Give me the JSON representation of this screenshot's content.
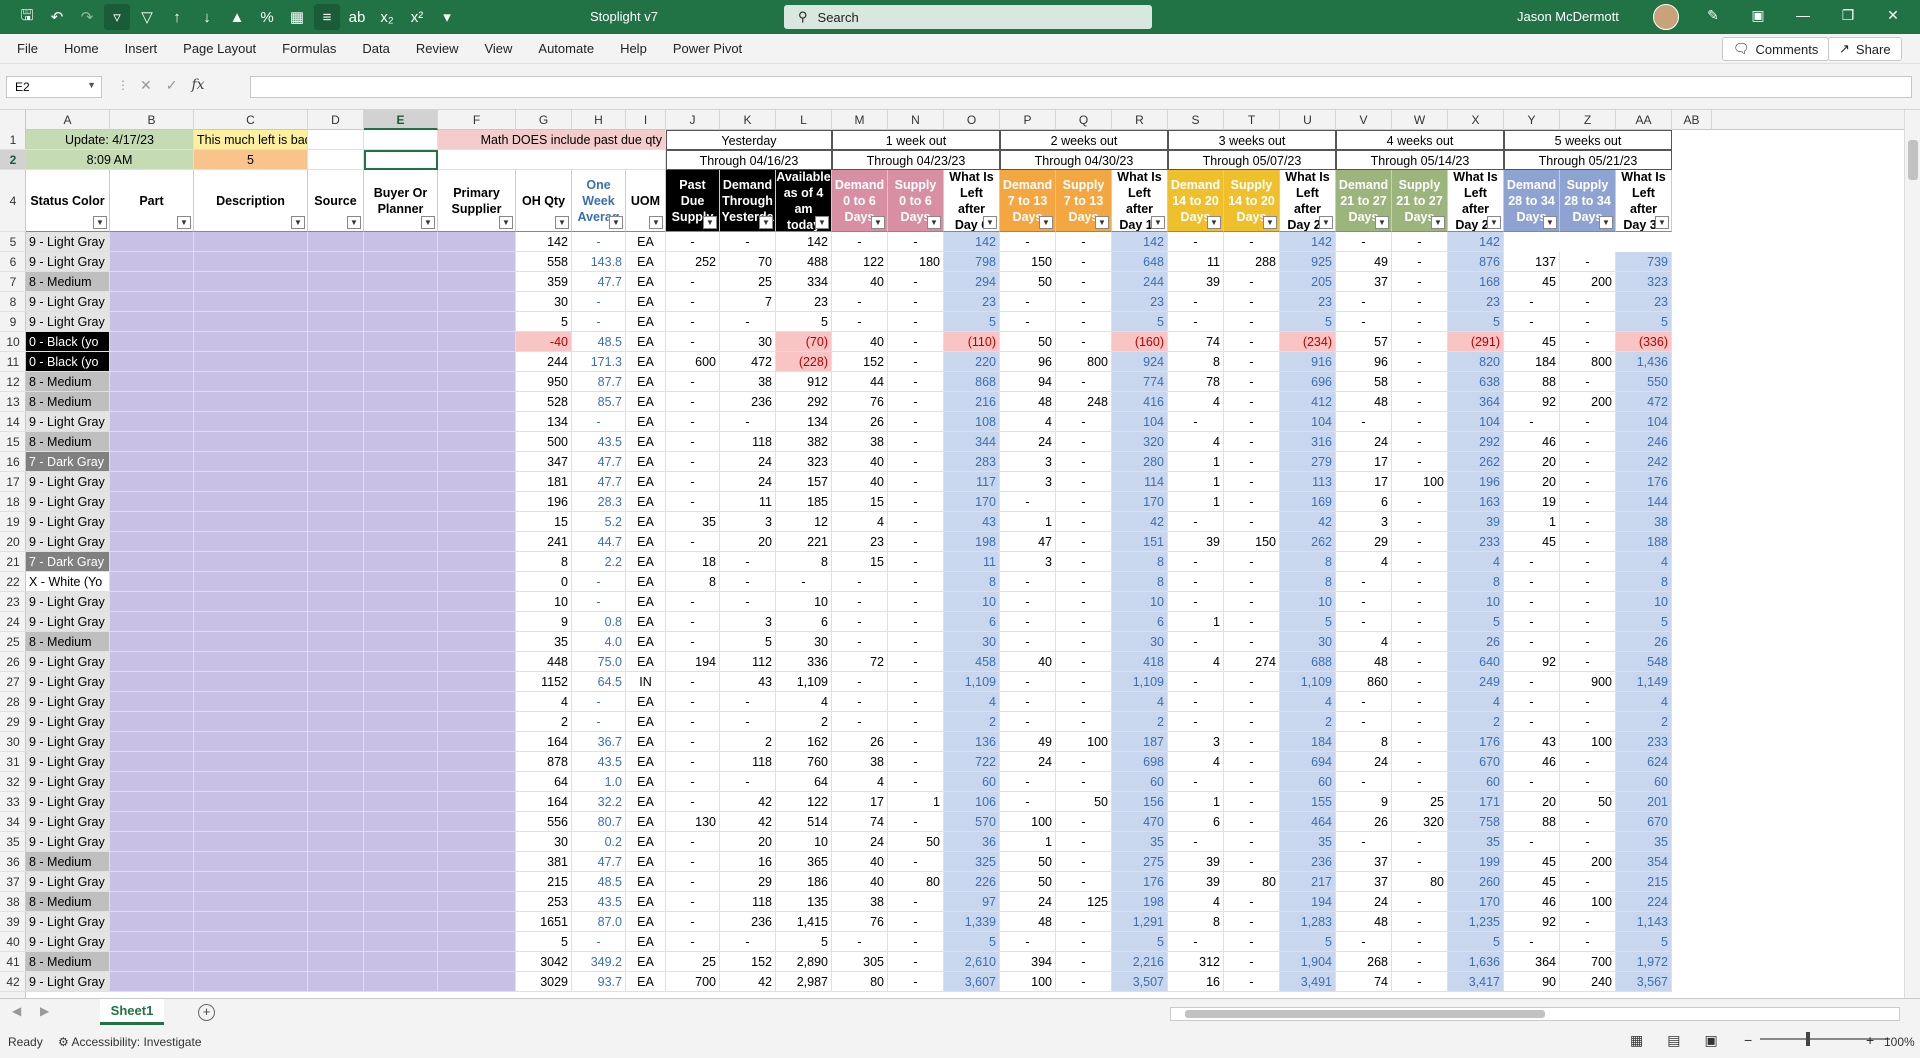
{
  "titlebar": {
    "doc_title": "Stoplight v7",
    "search_placeholder": "Search",
    "user_name": "Jason McDermott"
  },
  "menu": [
    "File",
    "Home",
    "Insert",
    "Page Layout",
    "Formulas",
    "Data",
    "Review",
    "View",
    "Automate",
    "Help",
    "Power Pivot"
  ],
  "buttons": {
    "comments": "Comments",
    "share": "Share"
  },
  "namebox": "E2",
  "columns": [
    "A",
    "B",
    "C",
    "D",
    "E",
    "F",
    "G",
    "H",
    "I",
    "J",
    "K",
    "L",
    "M",
    "N",
    "O",
    "P",
    "Q",
    "R",
    "S",
    "T",
    "U",
    "V",
    "W",
    "X",
    "Y",
    "Z",
    "AA",
    "AB"
  ],
  "selected_column": "E",
  "colors": {
    "excel_green": "#217346",
    "lavender": "#c9c0e6",
    "pink_header": "#d88fa3",
    "orange_header": "#f4a641",
    "yellow_header": "#f0c02c",
    "green_header": "#9bb57c",
    "blue_header": "#8ea3d1",
    "light_blue": "#c8d7ee",
    "light_red": "#f9c4c4"
  },
  "top_block": {
    "update_label": "Update: 4/17/23",
    "update_time": "8:09 AM",
    "bad_label": "This much left is bad",
    "bad_value": "5",
    "math_note": "Math DOES include past due qty"
  },
  "groups": [
    {
      "title": "Yesterday",
      "through": "Through 04/16/23"
    },
    {
      "title": "1 week out",
      "through": "Through 04/23/23"
    },
    {
      "title": "2 weeks out",
      "through": "Through 04/30/23"
    },
    {
      "title": "3 weeks out",
      "through": "Through 05/07/23"
    },
    {
      "title": "4 weeks out",
      "through": "Through 05/14/23"
    },
    {
      "title": "5 weeks out",
      "through": "Through 05/21/23"
    }
  ],
  "headers": [
    "Status Color",
    "Part",
    "Description",
    "Source",
    "Buyer Or Planner",
    "Primary Supplier",
    "OH Qty",
    "One Week Averag",
    "UOM",
    "Past Due Supply",
    "Demand Through Yesterda",
    "Available as of 4 am today",
    "Demand 0 to 6 Days",
    "Supply 0 to 6 Days",
    "What Is Left after Day 6",
    "Demand 7 to 13 Days",
    "Supply 7 to 13 Days",
    "What Is Left after Day 13",
    "Demand 14 to 20 Days",
    "Supply 14 to 20 Days",
    "What Is Left after Day 20",
    "Demand 21 to 27 Days",
    "Supply 21 to 27 Days",
    "What Is Left after Day 27",
    "Demand 28 to 34 Days",
    "Supply 28 to 34 Days",
    "What Is Left after Day 34"
  ],
  "rows": [
    [
      "9 - Light Gray",
      "142",
      "-",
      "EA",
      "-",
      "-",
      "142",
      "-",
      "-",
      "142",
      "-",
      "-",
      "142",
      "-",
      "-",
      "142",
      "-",
      "-",
      "142"
    ],
    [
      "9 - Light Gray",
      "558",
      "143.8",
      "EA",
      "252",
      "70",
      "488",
      "122",
      "180",
      "798",
      "150",
      "-",
      "648",
      "11",
      "288",
      "925",
      "49",
      "-",
      "876",
      "137",
      "-",
      "739"
    ],
    [
      "8 - Medium",
      "359",
      "47.7",
      "EA",
      "-",
      "25",
      "334",
      "40",
      "-",
      "294",
      "50",
      "-",
      "244",
      "39",
      "-",
      "205",
      "37",
      "-",
      "168",
      "45",
      "200",
      "323"
    ],
    [
      "9 - Light Gray",
      "30",
      "-",
      "EA",
      "-",
      "7",
      "23",
      "-",
      "-",
      "23",
      "-",
      "-",
      "23",
      "-",
      "-",
      "23",
      "-",
      "-",
      "23",
      "-",
      "-",
      "23"
    ],
    [
      "9 - Light Gray",
      "5",
      "-",
      "EA",
      "-",
      "-",
      "5",
      "-",
      "-",
      "5",
      "-",
      "-",
      "5",
      "-",
      "-",
      "5",
      "-",
      "-",
      "5",
      "-",
      "-",
      "5"
    ],
    [
      "0 - Black (yo",
      "-40",
      "48.5",
      "EA",
      "-",
      "30",
      "(70)",
      "40",
      "-",
      "(110)",
      "50",
      "-",
      "(160)",
      "74",
      "-",
      "(234)",
      "57",
      "-",
      "(291)",
      "45",
      "-",
      "(336)"
    ],
    [
      "0 - Black (yo",
      "244",
      "171.3",
      "EA",
      "600",
      "472",
      "(228)",
      "152",
      "-",
      "220",
      "96",
      "800",
      "924",
      "8",
      "-",
      "916",
      "96",
      "-",
      "820",
      "184",
      "800",
      "1,436"
    ],
    [
      "8 - Medium",
      "950",
      "87.7",
      "EA",
      "-",
      "38",
      "912",
      "44",
      "-",
      "868",
      "94",
      "-",
      "774",
      "78",
      "-",
      "696",
      "58",
      "-",
      "638",
      "88",
      "-",
      "550"
    ],
    [
      "8 - Medium",
      "528",
      "85.7",
      "EA",
      "-",
      "236",
      "292",
      "76",
      "-",
      "216",
      "48",
      "248",
      "416",
      "4",
      "-",
      "412",
      "48",
      "-",
      "364",
      "92",
      "200",
      "472"
    ],
    [
      "9 - Light Gray",
      "134",
      "-",
      "EA",
      "-",
      "-",
      "134",
      "26",
      "-",
      "108",
      "4",
      "-",
      "104",
      "-",
      "-",
      "104",
      "-",
      "-",
      "104",
      "-",
      "-",
      "104"
    ],
    [
      "8 - Medium",
      "500",
      "43.5",
      "EA",
      "-",
      "118",
      "382",
      "38",
      "-",
      "344",
      "24",
      "-",
      "320",
      "4",
      "-",
      "316",
      "24",
      "-",
      "292",
      "46",
      "-",
      "246"
    ],
    [
      "7 - Dark Gray",
      "347",
      "47.7",
      "EA",
      "-",
      "24",
      "323",
      "40",
      "-",
      "283",
      "3",
      "-",
      "280",
      "1",
      "-",
      "279",
      "17",
      "-",
      "262",
      "20",
      "-",
      "242"
    ],
    [
      "9 - Light Gray",
      "181",
      "47.7",
      "EA",
      "-",
      "24",
      "157",
      "40",
      "-",
      "117",
      "3",
      "-",
      "114",
      "1",
      "-",
      "113",
      "17",
      "100",
      "196",
      "20",
      "-",
      "176"
    ],
    [
      "9 - Light Gray",
      "196",
      "28.3",
      "EA",
      "-",
      "11",
      "185",
      "15",
      "-",
      "170",
      "-",
      "-",
      "170",
      "1",
      "-",
      "169",
      "6",
      "-",
      "163",
      "19",
      "-",
      "144"
    ],
    [
      "9 - Light Gray",
      "15",
      "5.2",
      "EA",
      "35",
      "3",
      "12",
      "4",
      "-",
      "43",
      "1",
      "-",
      "42",
      "-",
      "-",
      "42",
      "3",
      "-",
      "39",
      "1",
      "-",
      "38"
    ],
    [
      "9 - Light Gray",
      "241",
      "44.7",
      "EA",
      "-",
      "20",
      "221",
      "23",
      "-",
      "198",
      "47",
      "-",
      "151",
      "39",
      "150",
      "262",
      "29",
      "-",
      "233",
      "45",
      "-",
      "188"
    ],
    [
      "7 - Dark Gray",
      "8",
      "2.2",
      "EA",
      "18",
      "-",
      "8",
      "15",
      "-",
      "11",
      "3",
      "-",
      "8",
      "-",
      "-",
      "8",
      "4",
      "-",
      "4",
      "-",
      "-",
      "4"
    ],
    [
      "X - White (Yo",
      "0",
      "-",
      "EA",
      "8",
      "-",
      "-",
      "-",
      "-",
      "8",
      "-",
      "-",
      "8",
      "-",
      "-",
      "8",
      "-",
      "-",
      "8",
      "-",
      "-",
      "8"
    ],
    [
      "9 - Light Gray",
      "10",
      "-",
      "EA",
      "-",
      "-",
      "10",
      "-",
      "-",
      "10",
      "-",
      "-",
      "10",
      "-",
      "-",
      "10",
      "-",
      "-",
      "10",
      "-",
      "-",
      "10"
    ],
    [
      "9 - Light Gray",
      "9",
      "0.8",
      "EA",
      "-",
      "3",
      "6",
      "-",
      "-",
      "6",
      "-",
      "-",
      "6",
      "1",
      "-",
      "5",
      "-",
      "-",
      "5",
      "-",
      "-",
      "5"
    ],
    [
      "8 - Medium",
      "35",
      "4.0",
      "EA",
      "-",
      "5",
      "30",
      "-",
      "-",
      "30",
      "-",
      "-",
      "30",
      "-",
      "-",
      "30",
      "4",
      "-",
      "26",
      "-",
      "-",
      "26"
    ],
    [
      "9 - Light Gray",
      "448",
      "75.0",
      "EA",
      "194",
      "112",
      "336",
      "72",
      "-",
      "458",
      "40",
      "-",
      "418",
      "4",
      "274",
      "688",
      "48",
      "-",
      "640",
      "92",
      "-",
      "548"
    ],
    [
      "9 - Light Gray",
      "1152",
      "64.5",
      "IN",
      "-",
      "43",
      "1,109",
      "-",
      "-",
      "1,109",
      "-",
      "-",
      "1,109",
      "-",
      "-",
      "1,109",
      "860",
      "-",
      "249",
      "-",
      "900",
      "1,149"
    ],
    [
      "9 - Light Gray",
      "4",
      "-",
      "EA",
      "-",
      "-",
      "4",
      "-",
      "-",
      "4",
      "-",
      "-",
      "4",
      "-",
      "-",
      "4",
      "-",
      "-",
      "4",
      "-",
      "-",
      "4"
    ],
    [
      "9 - Light Gray",
      "2",
      "-",
      "EA",
      "-",
      "-",
      "2",
      "-",
      "-",
      "2",
      "-",
      "-",
      "2",
      "-",
      "-",
      "2",
      "-",
      "-",
      "2",
      "-",
      "-",
      "2"
    ],
    [
      "9 - Light Gray",
      "164",
      "36.7",
      "EA",
      "-",
      "2",
      "162",
      "26",
      "-",
      "136",
      "49",
      "100",
      "187",
      "3",
      "-",
      "184",
      "8",
      "-",
      "176",
      "43",
      "100",
      "233"
    ],
    [
      "9 - Light Gray",
      "878",
      "43.5",
      "EA",
      "-",
      "118",
      "760",
      "38",
      "-",
      "722",
      "24",
      "-",
      "698",
      "4",
      "-",
      "694",
      "24",
      "-",
      "670",
      "46",
      "-",
      "624"
    ],
    [
      "9 - Light Gray",
      "64",
      "1.0",
      "EA",
      "-",
      "-",
      "64",
      "4",
      "-",
      "60",
      "-",
      "-",
      "60",
      "-",
      "-",
      "60",
      "-",
      "-",
      "60",
      "-",
      "-",
      "60"
    ],
    [
      "9 - Light Gray",
      "164",
      "32.2",
      "EA",
      "-",
      "42",
      "122",
      "17",
      "1",
      "106",
      "-",
      "50",
      "156",
      "1",
      "-",
      "155",
      "9",
      "25",
      "171",
      "20",
      "50",
      "201"
    ],
    [
      "9 - Light Gray",
      "556",
      "80.7",
      "EA",
      "130",
      "42",
      "514",
      "74",
      "-",
      "570",
      "100",
      "-",
      "470",
      "6",
      "-",
      "464",
      "26",
      "320",
      "758",
      "88",
      "-",
      "670"
    ],
    [
      "9 - Light Gray",
      "30",
      "0.2",
      "EA",
      "-",
      "20",
      "10",
      "24",
      "50",
      "36",
      "1",
      "-",
      "35",
      "-",
      "-",
      "35",
      "-",
      "-",
      "35",
      "-",
      "-",
      "35"
    ],
    [
      "8 - Medium",
      "381",
      "47.7",
      "EA",
      "-",
      "16",
      "365",
      "40",
      "-",
      "325",
      "50",
      "-",
      "275",
      "39",
      "-",
      "236",
      "37",
      "-",
      "199",
      "45",
      "200",
      "354"
    ],
    [
      "9 - Light Gray",
      "215",
      "48.5",
      "EA",
      "-",
      "29",
      "186",
      "40",
      "80",
      "226",
      "50",
      "-",
      "176",
      "39",
      "80",
      "217",
      "37",
      "80",
      "260",
      "45",
      "-",
      "215"
    ],
    [
      "8 - Medium",
      "253",
      "43.5",
      "EA",
      "-",
      "118",
      "135",
      "38",
      "-",
      "97",
      "24",
      "125",
      "198",
      "4",
      "-",
      "194",
      "24",
      "-",
      "170",
      "46",
      "100",
      "224"
    ],
    [
      "9 - Light Gray",
      "1651",
      "87.0",
      "EA",
      "-",
      "236",
      "1,415",
      "76",
      "-",
      "1,339",
      "48",
      "-",
      "1,291",
      "8",
      "-",
      "1,283",
      "48",
      "-",
      "1,235",
      "92",
      "-",
      "1,143"
    ],
    [
      "9 - Light Gray",
      "5",
      "-",
      "EA",
      "-",
      "-",
      "5",
      "-",
      "-",
      "5",
      "-",
      "-",
      "5",
      "-",
      "-",
      "5",
      "-",
      "-",
      "5",
      "-",
      "-",
      "5"
    ],
    [
      "8 - Medium",
      "3042",
      "349.2",
      "EA",
      "25",
      "152",
      "2,890",
      "305",
      "-",
      "2,610",
      "394",
      "-",
      "2,216",
      "312",
      "-",
      "1,904",
      "268",
      "-",
      "1,636",
      "364",
      "700",
      "1,972"
    ],
    [
      "9 - Light Gray",
      "3029",
      "93.7",
      "EA",
      "700",
      "42",
      "2,987",
      "80",
      "-",
      "3,607",
      "100",
      "-",
      "3,507",
      "16",
      "-",
      "3,491",
      "74",
      "-",
      "3,417",
      "90",
      "240",
      "3,567"
    ]
  ],
  "sheet_tab": "Sheet1",
  "status": {
    "ready": "Ready",
    "accessibility": "Accessibility: Investigate",
    "zoom": "100%"
  }
}
